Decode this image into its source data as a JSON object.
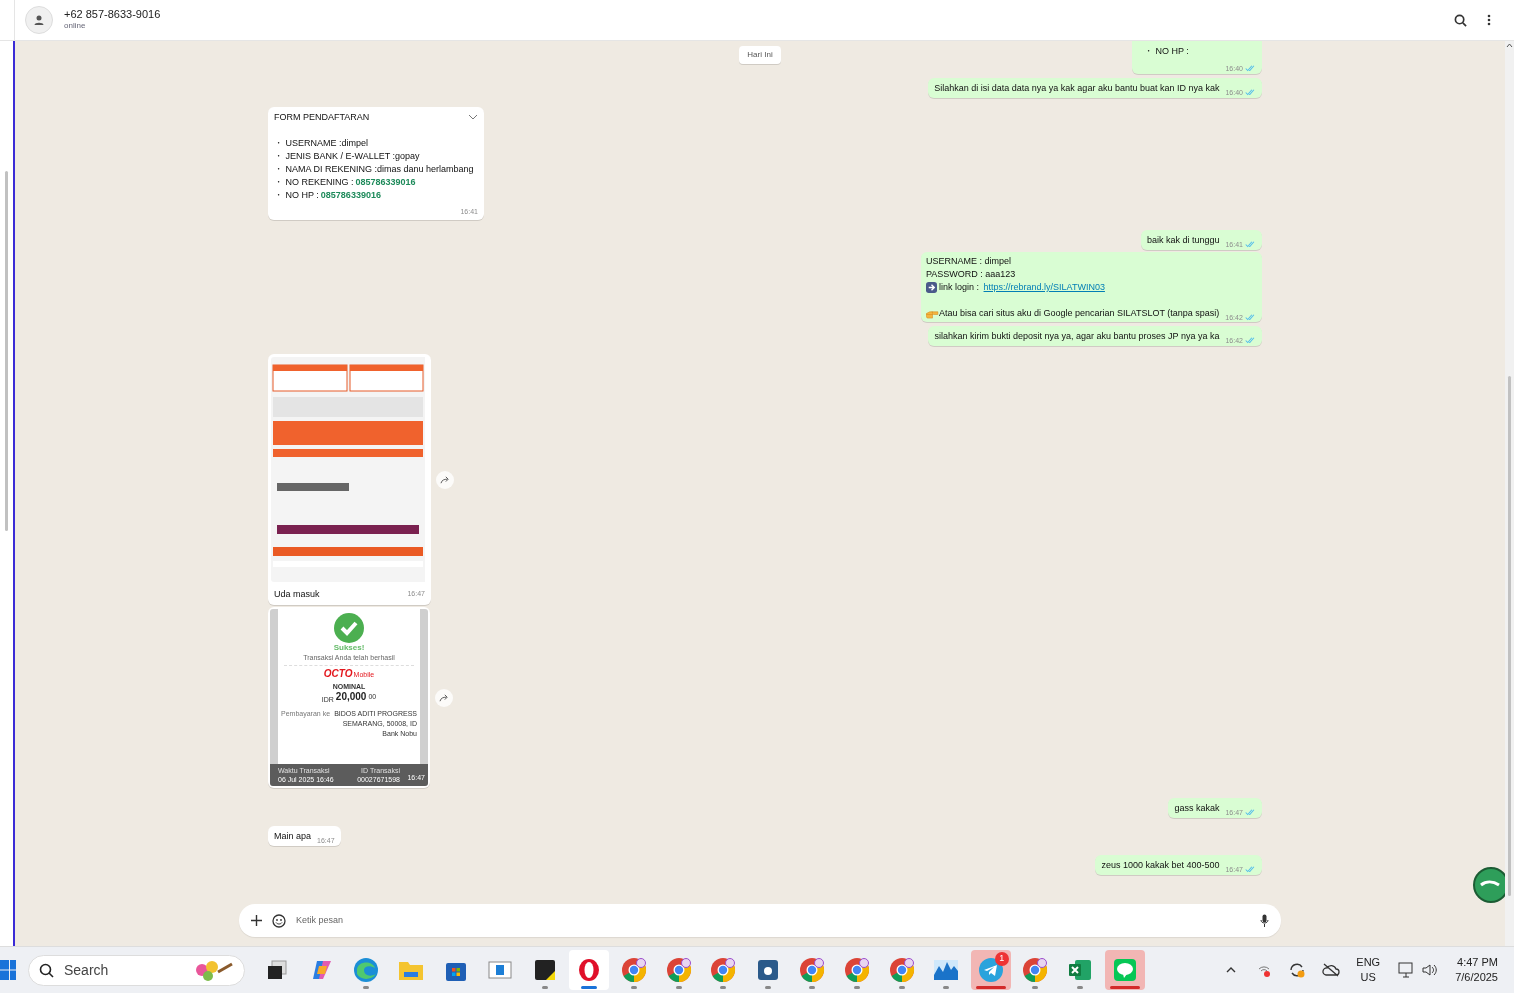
{
  "header": {
    "name": "+62 857-8633-9016",
    "status": "online"
  },
  "date_chip": "Hari Ini",
  "messages": [
    {
      "kind": "text",
      "outgoing": true,
      "read": true,
      "lines": [
        "・ NO HP :"
      ],
      "time": "16:40",
      "stacked_time": true
    },
    {
      "kind": "text",
      "outgoing": true,
      "read": true,
      "lines": [
        "Silahkan di isi data data nya ya kak agar aku bantu buat kan ID nya kak"
      ],
      "time": "16:40"
    },
    {
      "kind": "form",
      "outgoing": false,
      "title": "FORM PENDAFTARAN",
      "items": [
        {
          "label": "・ USERNAME :dimpel"
        },
        {
          "label": "・ JENIS BANK / E-WALLET :gopay"
        },
        {
          "label": "・ NAMA DI REKENING :dimas danu herlambang"
        },
        {
          "label": "・ NO REKENING :",
          "value": "085786339016"
        },
        {
          "label": "・ NO HP :",
          "value": "085786339016"
        }
      ],
      "time": "16:41"
    },
    {
      "kind": "text",
      "outgoing": true,
      "read": true,
      "lines": [
        "baik kak di tunggu"
      ],
      "time": "16:41"
    },
    {
      "kind": "login",
      "outgoing": true,
      "read": true,
      "lines": [
        "USERNAME : dimpel",
        "PASSWORD : aaa123"
      ],
      "link_label": "link login : ",
      "link": "https://rebrand.ly/SILATWIN03",
      "note": "Atau bisa cari situs aku di Google pencarian SILATSLOT (tanpa spasi)",
      "time": "16:42"
    },
    {
      "kind": "text",
      "outgoing": true,
      "read": true,
      "lines": [
        "silahkan kirim bukti deposit nya ya, agar aku bantu proses JP nya ya ka"
      ],
      "time": "16:42"
    },
    {
      "outgoing": false,
      "caption": "Uda masuk",
      "time": "16:47"
    },
    {
      "kind": "receipt",
      "outgoing": false,
      "title": "Sukses!",
      "subtitle": "Transaksi Anda telah berhasil",
      "brand": "OCTO",
      "brand_suffix": "Mobile",
      "amount_label": "NOMINAL",
      "currency": "IDR",
      "amount": "20,000",
      "cents": "00",
      "rows": [
        {
          "label": "Pembayaran ke",
          "value": "BIDOS ADITI PROGRESS"
        },
        {
          "value": "SEMARANG, 50008, ID"
        },
        {
          "value": "Bank Nobu"
        }
      ],
      "footer": [
        {
          "label": "Waktu Transaksi",
          "value": "06 Jul 2025 16:46"
        },
        {
          "label": "ID Transaksi",
          "value": "00027671598"
        }
      ],
      "time": "16:47"
    },
    {
      "kind": "text",
      "outgoing": true,
      "read": true,
      "lines": [
        "gass kakak"
      ],
      "time": "16:47"
    },
    {
      "kind": "text",
      "outgoing": false,
      "lines": [
        "Main apa"
      ],
      "time": "16:47"
    },
    {
      "kind": "text",
      "outgoing": true,
      "read": true,
      "lines": [
        "zeus 1000 kakak bet 400-500"
      ],
      "time": "16:47"
    }
  ],
  "composer": {
    "placeholder": "Ketik pesan"
  },
  "taskbar": {
    "search": "Search",
    "apps": [
      {
        "kind": "taskview",
        "running": false,
        "active": false
      },
      {
        "kind": "copilot",
        "running": false,
        "active": false
      },
      {
        "kind": "edge",
        "running": true,
        "active": false
      },
      {
        "kind": "files",
        "running": false,
        "active": false
      },
      {
        "kind": "store",
        "running": false,
        "active": false
      },
      {
        "kind": "window",
        "running": false,
        "active": false
      },
      {
        "kind": "notes",
        "running": true,
        "active": false
      },
      {
        "kind": "opera",
        "running": true,
        "active": true
      },
      {
        "kind": "chrome",
        "running": true,
        "active": false
      },
      {
        "kind": "chrome",
        "running": true,
        "active": false
      },
      {
        "kind": "chrome",
        "running": true,
        "active": false
      },
      {
        "kind": "blueapp",
        "running": true,
        "active": false
      },
      {
        "kind": "chrome",
        "running": true,
        "active": false
      },
      {
        "kind": "chrome",
        "running": true,
        "active": false
      },
      {
        "kind": "chrome",
        "running": true,
        "active": false
      },
      {
        "kind": "monitor",
        "running": true,
        "active": false
      },
      {
        "kind": "telegram",
        "running": true,
        "active": true,
        "badge": "1"
      },
      {
        "kind": "chrome",
        "running": true,
        "active": false
      },
      {
        "kind": "excel",
        "running": true,
        "active": false
      },
      {
        "kind": "line",
        "running": true,
        "active": true
      }
    ],
    "lang": "ENG",
    "region": "US",
    "time": "4:47 PM",
    "date": "7/6/2025"
  }
}
